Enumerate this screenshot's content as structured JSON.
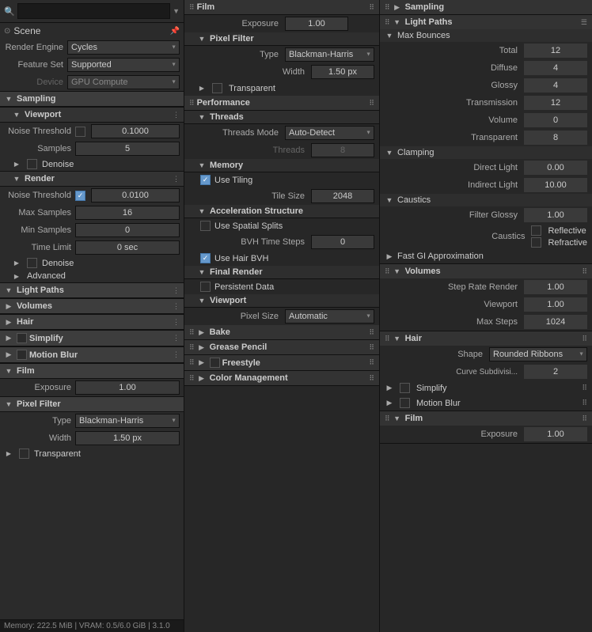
{
  "left": {
    "search_placeholder": "",
    "scene_label": "Scene",
    "pin_icon": "📌",
    "render_engine_label": "Render Engine",
    "render_engine_value": "Cycles",
    "feature_set_label": "Feature Set",
    "feature_set_value": "Supported",
    "device_label": "Device",
    "device_value": "GPU Compute",
    "sampling_label": "Sampling",
    "viewport_label": "Viewport",
    "noise_threshold_label": "Noise Threshold",
    "noise_threshold_value": "0.1000",
    "samples_label": "Samples",
    "samples_value": "5",
    "denoise_label": "Denoise",
    "render_label": "Render",
    "render_noise_threshold_label": "Noise Threshold",
    "render_noise_threshold_value": "0.0100",
    "max_samples_label": "Max Samples",
    "max_samples_value": "16",
    "min_samples_label": "Min Samples",
    "min_samples_value": "0",
    "time_limit_label": "Time Limit",
    "time_limit_value": "0 sec",
    "denoise2_label": "Denoise",
    "advanced_label": "Advanced",
    "light_paths_label": "Light Paths",
    "volumes_label": "Volumes",
    "hair_label": "Hair",
    "simplify_label": "Simplify",
    "motion_blur_label": "Motion Blur",
    "film_label": "Film",
    "exposure_label": "Exposure",
    "exposure_value": "1.00",
    "pixel_filter_label": "Pixel Filter",
    "type_label": "Type",
    "type_value": "Blackman-Harris",
    "width_label": "Width",
    "width_value": "1.50 px",
    "transparent_label": "Transparent",
    "status_bar": "Memory: 222.5 MiB | VRAM: 0.5/6.0 GiB | 3.1.0"
  },
  "mid": {
    "film_label": "Film",
    "exposure_label": "Exposure",
    "exposure_value": "1.00",
    "pixel_filter_label": "Pixel Filter",
    "pf_type_label": "Type",
    "pf_type_value": "Blackman-Harris",
    "pf_width_label": "Width",
    "pf_width_value": "1.50 px",
    "transparent_label": "Transparent",
    "performance_label": "Performance",
    "threads_label": "Threads",
    "threads_mode_label": "Threads Mode",
    "threads_mode_value": "Auto-Detect",
    "threads_label2": "Threads",
    "threads_value": "8",
    "memory_label": "Memory",
    "use_tiling_label": "Use Tiling",
    "tile_size_label": "Tile Size",
    "tile_size_value": "2048",
    "accel_structure_label": "Acceleration Structure",
    "use_spatial_splits_label": "Use Spatial Splits",
    "bvh_time_steps_label": "BVH Time Steps",
    "bvh_time_steps_value": "0",
    "use_hair_bvh_label": "Use Hair BVH",
    "final_render_label": "Final Render",
    "persistent_data_label": "Persistent Data",
    "viewport2_label": "Viewport",
    "pixel_size_label": "Pixel Size",
    "pixel_size_value": "Automatic",
    "bake_label": "Bake",
    "grease_pencil_label": "Grease Pencil",
    "freestyle_label": "Freestyle",
    "color_management_label": "Color Management"
  },
  "right": {
    "sampling_label": "Sampling",
    "light_paths_label": "Light Paths",
    "max_bounces_label": "Max Bounces",
    "total_label": "Total",
    "total_value": "12",
    "diffuse_label": "Diffuse",
    "diffuse_value": "4",
    "glossy_label": "Glossy",
    "glossy_value": "4",
    "transmission_label": "Transmission",
    "transmission_value": "12",
    "volume_label": "Volume",
    "volume_value": "0",
    "transparent_label": "Transparent",
    "transparent_value": "8",
    "clamping_label": "Clamping",
    "direct_light_label": "Direct Light",
    "direct_light_value": "0.00",
    "indirect_light_label": "Indirect Light",
    "indirect_light_value": "10.00",
    "caustics_label": "Caustics",
    "filter_glossy_label": "Filter Glossy",
    "filter_glossy_value": "1.00",
    "caustics2_label": "Caustics",
    "reflective_label": "Reflective",
    "refractive_label": "Refractive",
    "fast_gi_label": "Fast GI Approximation",
    "volumes_label": "Volumes",
    "step_rate_render_label": "Step Rate Render",
    "step_rate_render_value": "1.00",
    "viewport_label": "Viewport",
    "viewport_value": "1.00",
    "max_steps_label": "Max Steps",
    "max_steps_value": "1024",
    "hair_label": "Hair",
    "shape_label": "Shape",
    "shape_value": "Rounded Ribbons",
    "curve_subdiv_label": "Curve Subdivisi...",
    "curve_subdiv_value": "2",
    "simplify_label": "Simplify",
    "motion_blur_label": "Motion Blur",
    "film_label": "Film",
    "exposure2_label": "Exposure",
    "exposure2_value": "1.00"
  }
}
